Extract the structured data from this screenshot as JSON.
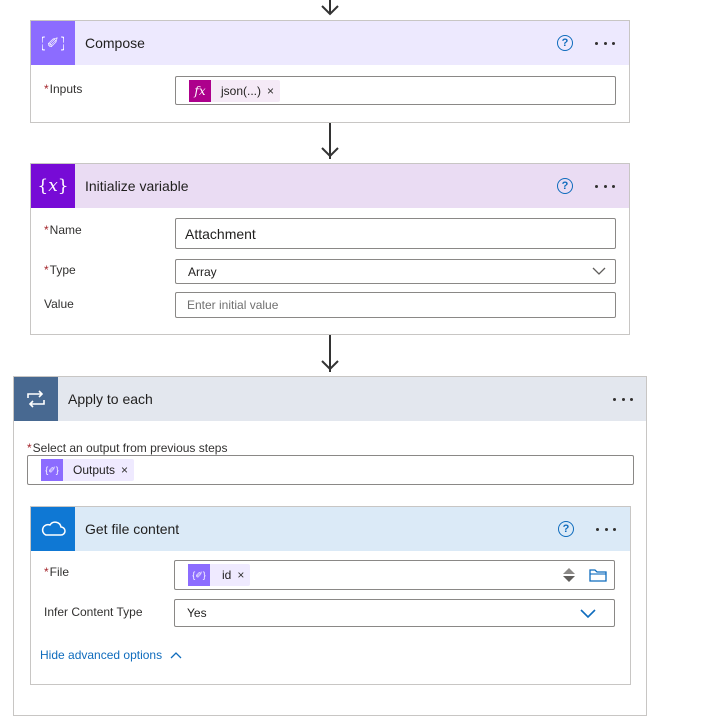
{
  "compose": {
    "title": "Compose",
    "inputs_label": "Inputs",
    "token_label": "json(...)",
    "token_remove": "×",
    "icon": "code-braces-icon",
    "colors": {
      "header": "#ede9fe",
      "icon": "#8c6cff"
    }
  },
  "init_variable": {
    "title": "Initialize variable",
    "name_label": "Name",
    "name_value": "Attachment",
    "type_label": "Type",
    "type_value": "Array",
    "value_label": "Value",
    "value_placeholder": "Enter initial value",
    "icon": "variable-braces-icon",
    "colors": {
      "header": "#eadcf3",
      "icon": "#770bd6"
    }
  },
  "apply_each": {
    "title": "Apply to each",
    "select_label": "Select an output from previous steps",
    "token_label": "Outputs",
    "token_remove": "×",
    "icon": "loop-icon",
    "colors": {
      "header": "#e3e7ee",
      "icon": "#486991"
    }
  },
  "get_file": {
    "title": "Get file content",
    "file_label": "File",
    "token_label": "id",
    "token_remove": "×",
    "infer_label": "Infer Content Type",
    "infer_value": "Yes",
    "hide_advanced": "Hide advanced options",
    "icon": "onedrive-cloud-icon",
    "colors": {
      "header": "#dbeaf7",
      "icon": "#0f78d4"
    }
  },
  "common": {
    "help_glyph": "?",
    "required_mark": "*",
    "accent": "#0f6cbd",
    "required": "#a4262c"
  }
}
